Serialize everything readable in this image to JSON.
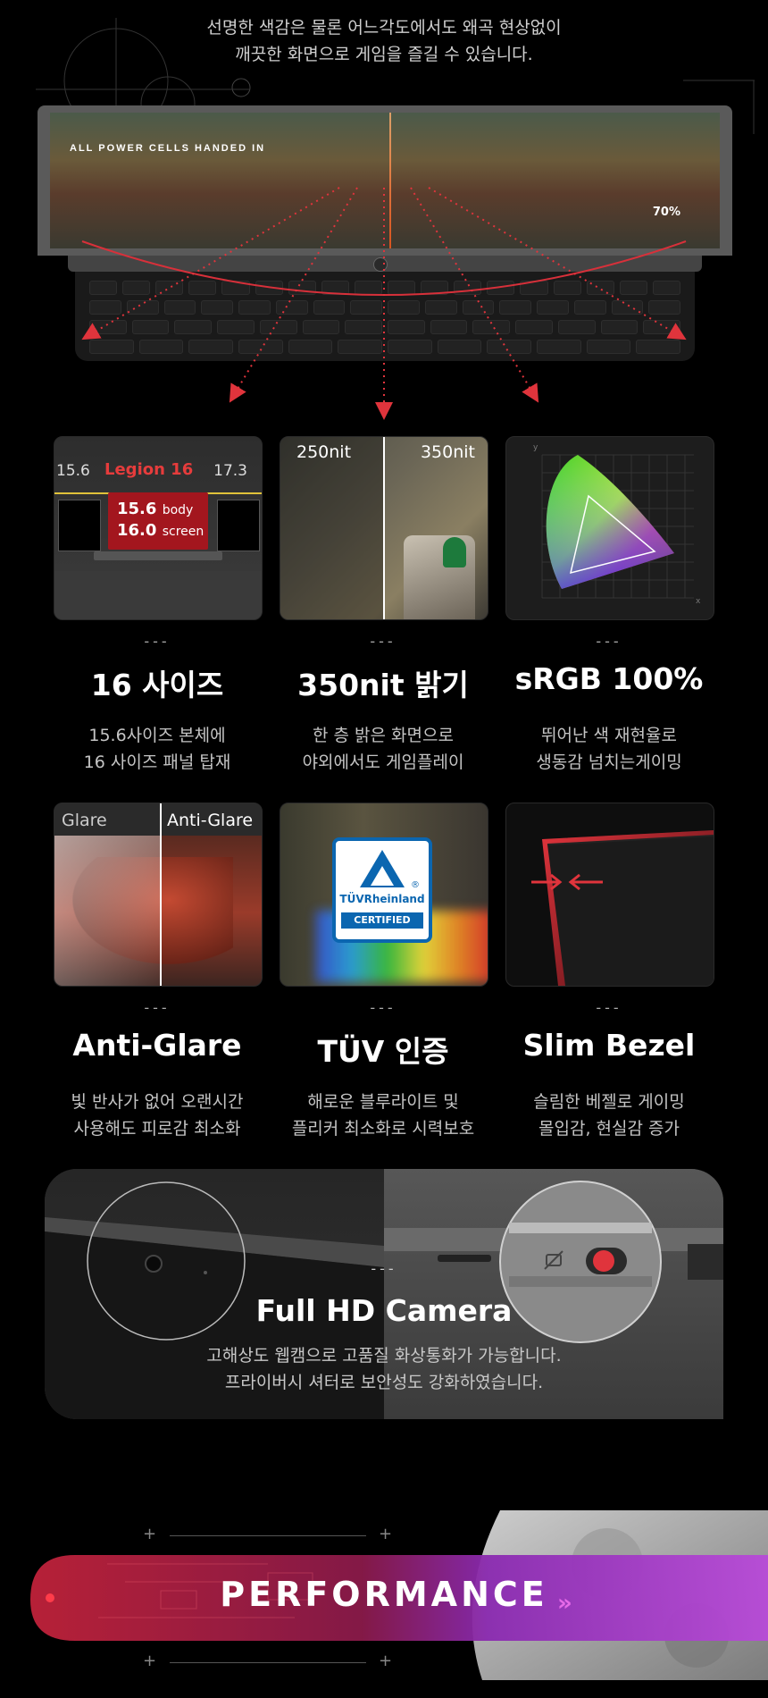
{
  "intro": {
    "line1": "선명한 색감은 물론 어느각도에서도 왜곡 현상없이",
    "line2": "깨끗한 화면으로 게임을 즐길 수 있습니다."
  },
  "laptop_screen": {
    "banner": "ALL POWER CELLS HANDED IN",
    "percent": "70%"
  },
  "features": [
    {
      "dash": "---",
      "title": "16 사이즈",
      "desc1": "15.6사이즈 본체에",
      "desc2": "16 사이즈 패널 탑재",
      "visual": {
        "left_label": "15.6",
        "center_label": "Legion 16",
        "right_label": "17.3",
        "body_value": "15.6",
        "body_unit": "body",
        "screen_value": "16.0",
        "screen_unit": "screen"
      }
    },
    {
      "dash": "---",
      "title": "350nit 밝기",
      "desc1": "한 층 밝은 화면으로",
      "desc2": "야외에서도 게임플레이",
      "visual": {
        "left_label": "250nit",
        "right_label": "350nit"
      }
    },
    {
      "dash": "---",
      "title": "sRGB 100%",
      "desc1": "뛰어난 색 재현율로",
      "desc2": "생동감 넘치는게이밍",
      "visual": {
        "y_axis": "y",
        "x_axis": "x"
      }
    },
    {
      "dash": "---",
      "title": "Anti-Glare",
      "desc1": "빛 반사가 없어 오랜시간",
      "desc2": "사용해도 피로감 최소화",
      "visual": {
        "left_label": "Glare",
        "right_label": "Anti-Glare"
      }
    },
    {
      "dash": "---",
      "title": "TÜV 인증",
      "desc1": "해로운 블루라이트 및",
      "desc2": "플리커 최소화로 시력보호",
      "visual": {
        "brand": "TÜVRheinland",
        "badge": "CERTIFIED",
        "reg": "®"
      }
    },
    {
      "dash": "---",
      "title": "Slim Bezel",
      "desc1": "슬림한 베젤로 게이밍",
      "desc2": "몰입감, 현실감 증가",
      "visual": {}
    }
  ],
  "camera": {
    "dash": "---",
    "title": "Full HD Camera",
    "desc1": "고해상도 웹캠으로 고품질 화상통화가 가능합니다.",
    "desc2": "프라이버시 셔터로 보안성도 강화하였습니다."
  },
  "performance": {
    "label": "PERFORMANCE",
    "chevrons": "»"
  },
  "colors": {
    "accent_red": "#e63c3c",
    "bezel_red": "#c81e28",
    "perf_red": "#c0223a",
    "perf_purple": "#a43bc8"
  }
}
